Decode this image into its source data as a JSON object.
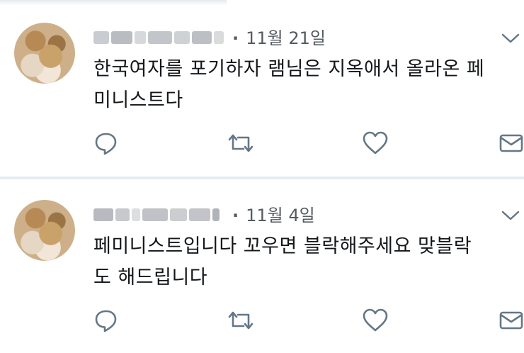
{
  "tweets": [
    {
      "date": "11월 21일",
      "text_line1": "한국여자를 포기하자 램님은 지옥애서 올라온 페",
      "text_line2": "미니스트다"
    },
    {
      "date": "11월 4일",
      "text_line1": "페미니스트입니다 꼬우면 블락해주세요 맞블락",
      "text_line2": "도 해드립니다"
    }
  ],
  "icons": {
    "reply": "reply-icon",
    "retweet": "retweet-icon",
    "like": "heart-icon",
    "dm": "envelope-icon",
    "menu": "chevron-down-icon"
  },
  "colors": {
    "text": "#14171a",
    "meta": "#555b60",
    "icon": "#657786",
    "divider": "#e6ecf0"
  }
}
